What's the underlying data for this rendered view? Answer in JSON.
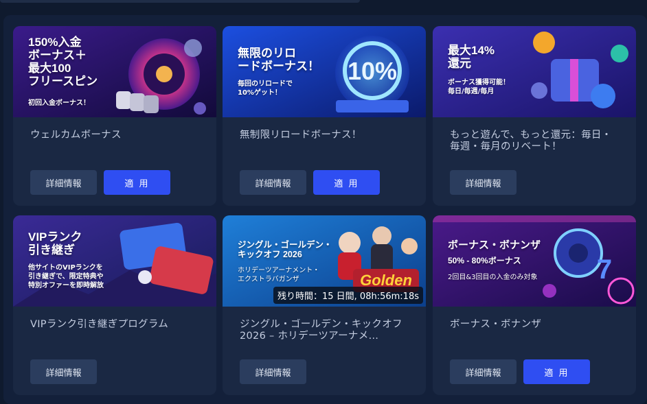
{
  "cards": [
    {
      "banner_lines": [
        "150%入金",
        "ボーナス＋",
        "最大100",
        "フリースピン"
      ],
      "banner_sub": "初回入金ボーナス！",
      "title": "ウェルカムボーナス",
      "info_label": "詳細情報",
      "apply_label": "適 用"
    },
    {
      "banner_lines": [
        "無限のリロ",
        "ードボーナス！"
      ],
      "banner_sub_lines": [
        "毎回のリロードで",
        "10%ゲット！"
      ],
      "banner_graphic_text": "10%",
      "title": "無制限リロードボーナス！",
      "info_label": "詳細情報",
      "apply_label": "適 用"
    },
    {
      "banner_lines": [
        "最大14%",
        "還元"
      ],
      "banner_sub_lines": [
        "ボーナス獲得可能！",
        "毎日/毎週/毎月"
      ],
      "title": "もっと遊んで、もっと還元：毎日・毎週・毎月のリベート！",
      "info_label": "詳細情報"
    },
    {
      "banner_lines": [
        "VIPランク",
        "引き継ぎ"
      ],
      "banner_sub_lines": [
        "他サイトのVIPランクを",
        "引き継ぎで、限定特典や",
        "特別オファーを即時解放"
      ],
      "title": "VIPランク引き継ぎプログラム",
      "info_label": "詳細情報"
    },
    {
      "banner_lines": [
        "ジングル・ゴールデン・",
        "キックオフ 2026"
      ],
      "banner_sub_lines": [
        "ホリデーツアーナメント・",
        "エクストラバガンザ"
      ],
      "banner_graphic_text": "Golden",
      "timer": "残り時間：15 日間, 08h:56m:18s",
      "title": "ジングル・ゴールデン・キックオフ 2026 – ホリデーツアーナメ…",
      "info_label": "詳細情報"
    },
    {
      "banner_lines": [
        "ボーナス・ボナンザ"
      ],
      "banner_sub_lines": [
        "50% - 80%ボーナス"
      ],
      "banner_sub2": "2回目&3回目の入金のみ対象",
      "title": "ボーナス・ボナンザ",
      "info_label": "詳細情報",
      "apply_label": "適 用"
    }
  ],
  "colors": {
    "page_bg": "#0f1a2e",
    "card_bg": "#1a2843",
    "info_button": "#2b3d5e",
    "apply_button": "#2f4ef2"
  }
}
